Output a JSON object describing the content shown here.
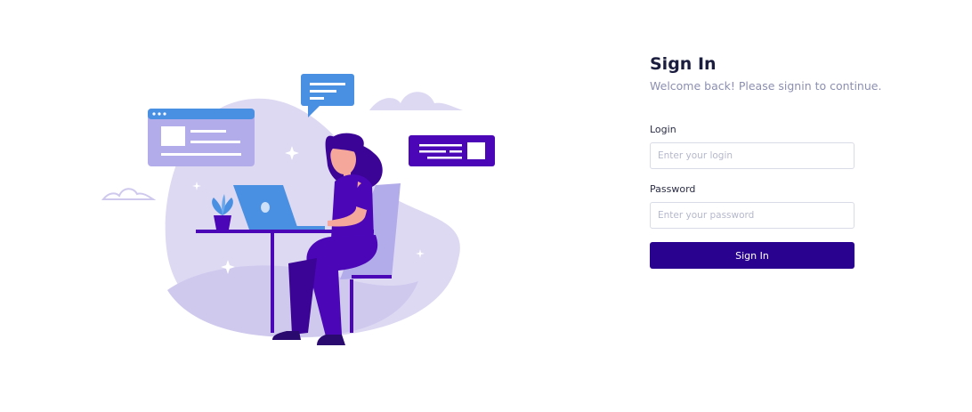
{
  "signin": {
    "title": "Sign In",
    "subtitle": "Welcome back! Please signin to continue.",
    "login_label": "Login",
    "login_placeholder": "Enter your login",
    "password_label": "Password",
    "password_placeholder": "Enter your password",
    "button_label": "Sign In"
  },
  "colors": {
    "primary": "#2a0290",
    "heading": "#1b1d3f",
    "muted": "#8c8fb0",
    "illustration_light": "#ddd9f3",
    "illustration_blue": "#4a90e2",
    "illustration_purple": "#4b06b8"
  },
  "icons": [
    "woman-at-laptop-illustration",
    "chat-bubble-icon",
    "browser-window-icon",
    "message-card-icon",
    "plant-icon",
    "cloud-icon",
    "sparkle-icon"
  ]
}
